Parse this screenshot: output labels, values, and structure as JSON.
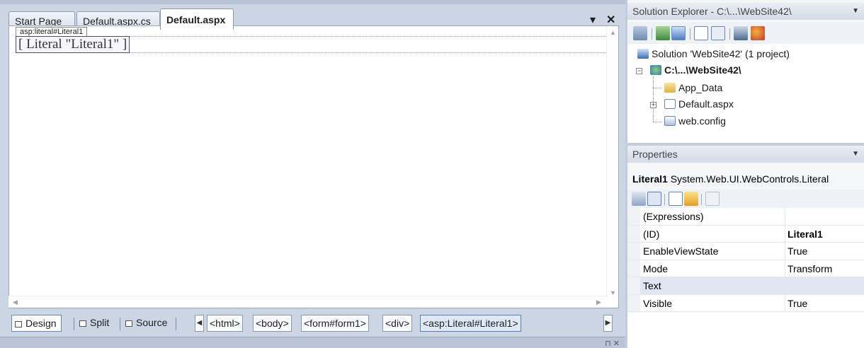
{
  "editor": {
    "tabs": [
      {
        "label": "Start Page"
      },
      {
        "label": "Default.aspx.cs"
      },
      {
        "label": "Default.aspx"
      }
    ],
    "tab_dropdown_glyph": "▾",
    "close_glyph": "✕",
    "literal_badge": "asp:literal#Literal1",
    "literal_control_text": "[ Literal \"Literal1\" ]",
    "views": {
      "design": "Design",
      "split": "Split",
      "source": "Source"
    },
    "breadcrumbs": [
      "<html>",
      "<body>",
      "<form#form1>",
      "<div>",
      "<asp:Literal#Literal1>"
    ]
  },
  "solution_explorer": {
    "title": "Solution Explorer - C:\\...\\WebSite42\\",
    "solution_label": "Solution 'WebSite42' (1 project)",
    "project_label": "C:\\...\\WebSite42\\",
    "items": [
      {
        "label": "App_Data"
      },
      {
        "label": "Default.aspx"
      },
      {
        "label": "web.config"
      }
    ]
  },
  "properties": {
    "title": "Properties",
    "object_name": "Literal1",
    "object_type": "System.Web.UI.WebControls.Literal",
    "rows": [
      {
        "name": "(Expressions)",
        "value": ""
      },
      {
        "name": "(ID)",
        "value": "Literal1"
      },
      {
        "name": "EnableViewState",
        "value": "True"
      },
      {
        "name": "Mode",
        "value": "Transform"
      },
      {
        "name": "Text",
        "value": ""
      },
      {
        "name": "Visible",
        "value": "True"
      }
    ]
  },
  "colors": {
    "chrome_bg": "#ccd5e4",
    "selection": "#dfe8f7",
    "accent": "#5a7bbf"
  }
}
